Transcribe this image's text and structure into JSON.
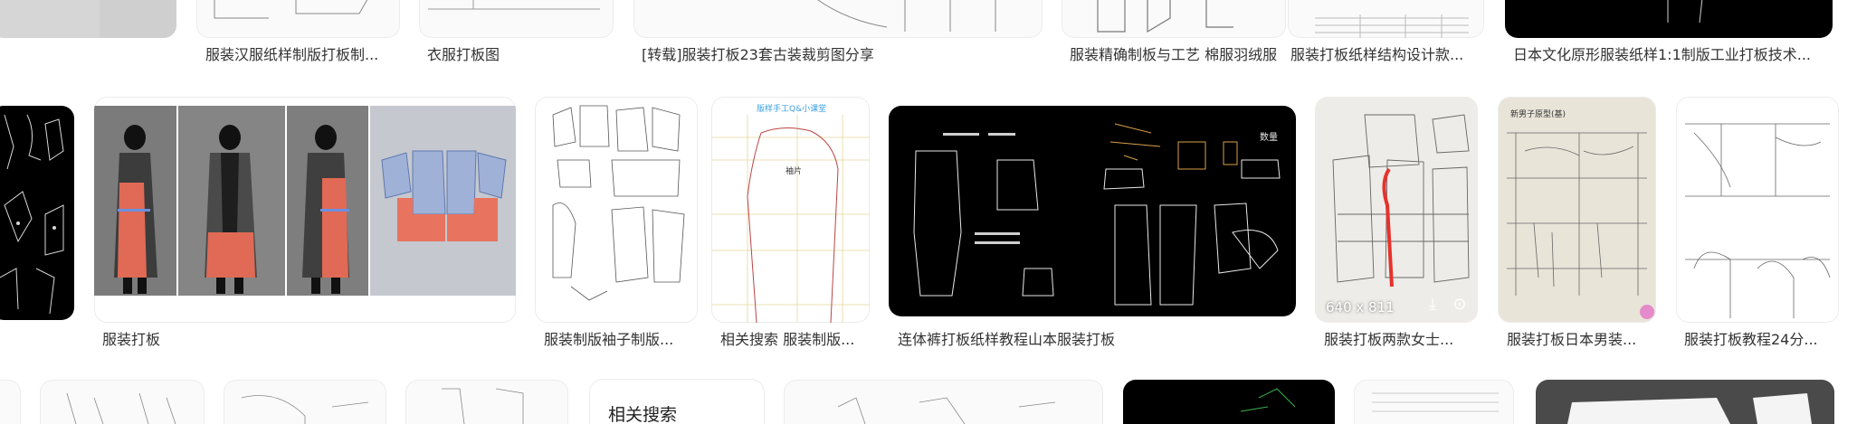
{
  "row1": {
    "captions": [
      "服装汉服纸样制版打板制...",
      "衣服打板图",
      "[转载]服装打板23套古装裁剪图分享",
      "服装精确制板与工艺 棉服羽绒服",
      "服装打板纸样结构设计款...",
      "日本文化原形服装纸样1:1制版工业打板技术..."
    ]
  },
  "row2": {
    "captions": [
      "服装打板",
      "服装制版袖子制版...",
      "相关搜索 服装制版...",
      "连体裤打板纸样教程山本服装打板",
      "服装打板两款女士...",
      "服装打板日本男装...",
      "服装打板教程24分..."
    ],
    "hovered_tile": {
      "size_label": "640 x 811",
      "icons": [
        "download-icon",
        "visual-search-icon"
      ]
    },
    "pattern_texts": {
      "sleeve_sheet_header": "版样手工Q&小课堂",
      "sleeve_piece_label": "袖片",
      "jumpsuit_side_label": "数量",
      "notebook_title": "新男子原型(基)"
    }
  },
  "row3": {
    "related_search_title": "相关搜索"
  },
  "colors": {
    "accent_red": "#e6322b",
    "muted_red": "#d9644f",
    "caption_text": "#333333"
  }
}
